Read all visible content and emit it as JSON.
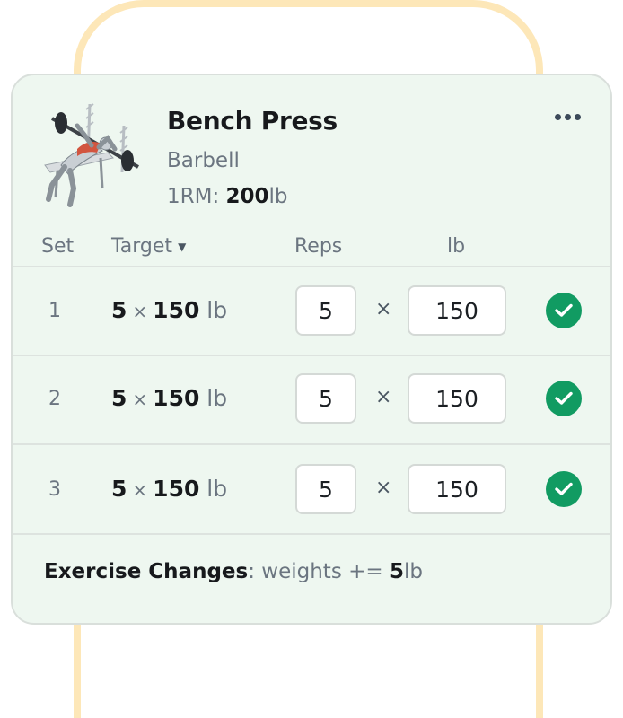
{
  "exercise": {
    "name": "Bench Press",
    "equipment": "Barbell",
    "one_rm_label": "1RM: ",
    "one_rm_value": "200",
    "one_rm_unit": "lb"
  },
  "columns": {
    "set": "Set",
    "target": "Target",
    "reps": "Reps",
    "weight": "lb"
  },
  "sets": [
    {
      "number": "1",
      "target_reps": "5",
      "target_times": "×",
      "target_weight": "150",
      "target_unit": " lb",
      "reps": "5",
      "times": "×",
      "weight": "150",
      "completed": true
    },
    {
      "number": "2",
      "target_reps": "5",
      "target_times": "×",
      "target_weight": "150",
      "target_unit": " lb",
      "reps": "5",
      "times": "×",
      "weight": "150",
      "completed": true
    },
    {
      "number": "3",
      "target_reps": "5",
      "target_times": "×",
      "target_weight": "150",
      "target_unit": " lb",
      "reps": "5",
      "times": "×",
      "weight": "150",
      "completed": true
    }
  ],
  "changes": {
    "label": "Exercise Changes",
    "text": ": weights += ",
    "value": "5",
    "unit": "lb"
  },
  "colors": {
    "card_bg": "#eef7f0",
    "check_green": "#119b62",
    "frame": "#fde7b8"
  },
  "icons": {
    "more": "more-horizontal-icon",
    "check": "check-circle-icon",
    "caret": "caret-down-icon"
  }
}
